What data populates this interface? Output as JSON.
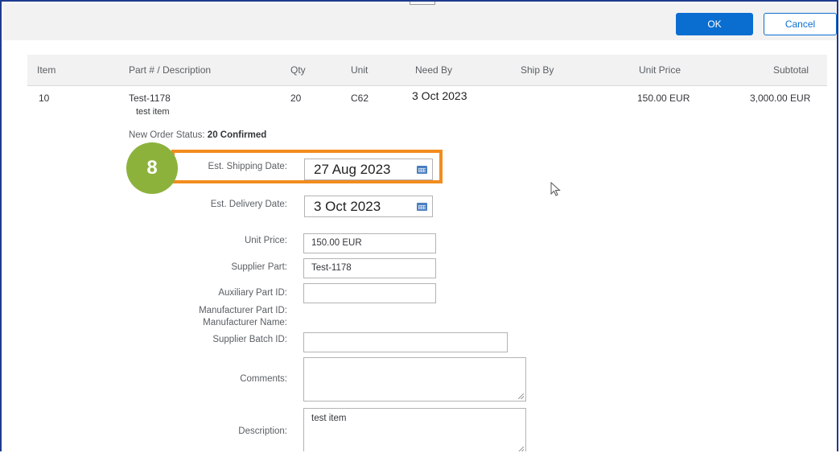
{
  "toolbar": {
    "ok_label": "OK",
    "cancel_label": "Cancel"
  },
  "table": {
    "headers": [
      "Item",
      "Part # / Description",
      "Qty",
      "Unit",
      "Need By",
      "Ship By",
      "Unit Price",
      "Subtotal"
    ],
    "row": {
      "item": "10",
      "part_number": "Test-1178",
      "description": "test item",
      "qty": "20",
      "unit": "C62",
      "need_by": "3 Oct 2023",
      "ship_by": "",
      "unit_price": "150.00 EUR",
      "subtotal": "3,000.00 EUR"
    }
  },
  "order_status": {
    "label": "New Order Status:",
    "value": "20 Confirmed"
  },
  "step_badge": "8",
  "form": {
    "est_shipping_date": {
      "label": "Est. Shipping Date:",
      "value": "27 Aug 2023",
      "icon": "calendar-icon"
    },
    "est_delivery_date": {
      "label": "Est. Delivery Date:",
      "value": "3 Oct 2023",
      "icon": "calendar-icon"
    },
    "unit_price": {
      "label": "Unit Price:",
      "value": "150.00 EUR"
    },
    "supplier_part": {
      "label": "Supplier Part:",
      "value": "Test-1178"
    },
    "auxiliary_part_id": {
      "label": "Auxiliary Part ID:",
      "value": ""
    },
    "manufacturer_part_id": {
      "label": "Manufacturer Part ID:"
    },
    "manufacturer_name": {
      "label": "Manufacturer Name:"
    },
    "supplier_batch_id": {
      "label": "Supplier Batch ID:",
      "value": ""
    },
    "comments": {
      "label": "Comments:",
      "value": ""
    },
    "description": {
      "label": "Description:",
      "value": "test item"
    }
  },
  "colors": {
    "accent": "#0a6ed1",
    "highlight": "#f28c1e",
    "badge": "#8cb23c"
  }
}
